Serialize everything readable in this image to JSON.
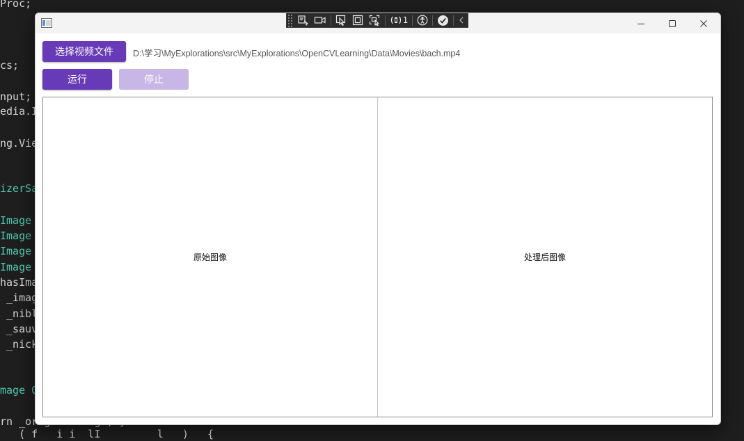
{
  "code_editor": {
    "lines": [
      {
        "text": "Proc;",
        "kind": "plain"
      },
      {
        "text": "cs;",
        "kind": "plain"
      },
      {
        "text": "nput;",
        "kind": "plain"
      },
      {
        "text": "edia.I",
        "kind": "plain"
      },
      {
        "text": "ng.Vie",
        "kind": "plain"
      },
      {
        "text": "izerSa",
        "kind": "type"
      },
      {
        "text": "Image",
        "kind": "type"
      },
      {
        "text": "Image",
        "kind": "type"
      },
      {
        "text": "Image",
        "kind": "type"
      },
      {
        "text": "Image",
        "kind": "type"
      },
      {
        "text": "hasIma",
        "kind": "plain"
      },
      {
        "text": " _imag",
        "kind": "plain"
      },
      {
        "text": " _nibl",
        "kind": "plain"
      },
      {
        "text": " _sauv",
        "kind": "plain"
      },
      {
        "text": " _nick",
        "kind": "plain"
      },
      {
        "text": "mage O",
        "kind": "type"
      },
      {
        "text": "rn _originalImage; }",
        "kind": "plain"
      },
      {
        "text": "   ( f   i i  lI         l   )   {",
        "kind": "plain"
      }
    ]
  },
  "xaml_toolbar": {
    "items": [
      "select-element-icon",
      "record-icon",
      "pointer-select-icon",
      "layout-adorner-icon",
      "track-focus-icon",
      "binding-failures-icon",
      "accessibility-icon",
      "checked-icon",
      "collapse-icon"
    ],
    "binding_failure_count": "1"
  },
  "window": {
    "controls": [
      "minimize-icon",
      "maximize-icon",
      "close-icon"
    ]
  },
  "toolbar": {
    "select_video_label": "选择视频文件",
    "file_path": "D:\\学习\\MyExplorations\\src\\MyExplorations\\OpenCVLearning\\Data\\Movies\\bach.mp4",
    "run_label": "运行",
    "stop_label": "停止"
  },
  "panes": {
    "original_label": "原始图像",
    "processed_label": "处理后图像"
  },
  "colors": {
    "accent": "#673ab7",
    "accent_disabled": "#c7b6e6",
    "editor_background": "#1e1e1e",
    "editor_type": "#4ec9b0"
  }
}
